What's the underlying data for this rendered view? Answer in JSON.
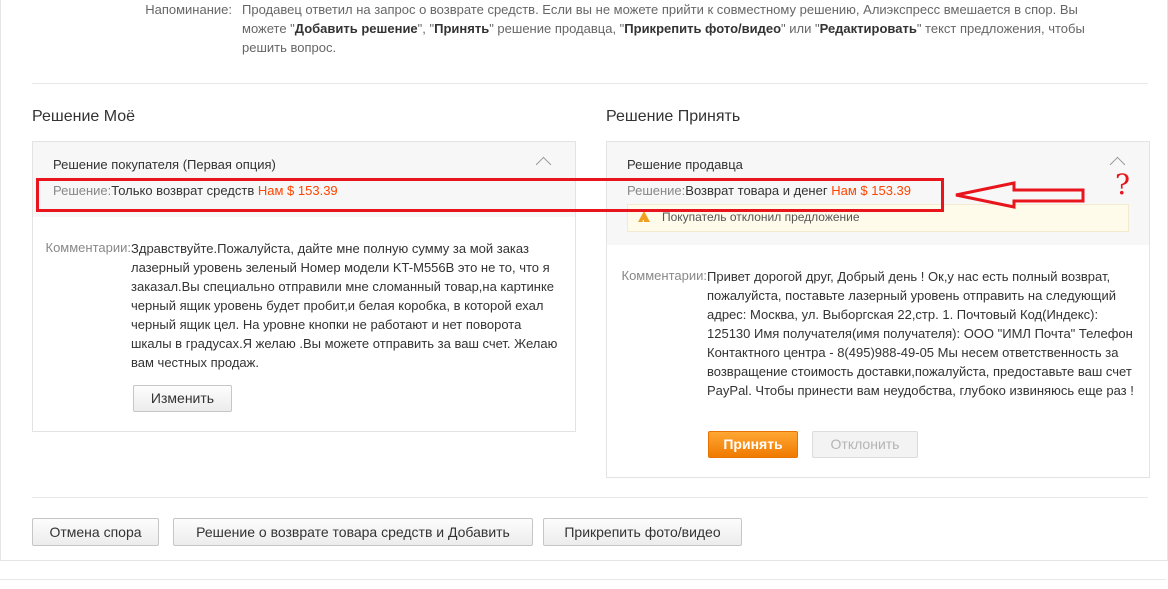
{
  "reminder": {
    "label": "Напоминание:",
    "text_plain1": "Продавец ответил на запрос о возврате средств. Если вы не можете прийти к совместному решению, Алиэкспресс вмешается в спор. Вы можете \"",
    "b1": "Добавить решение",
    "t2": "\", \"",
    "b2": "Принять",
    "t3": "\" решение продавца, \"",
    "b3": "Прикрепить фото/видео",
    "t4": "\" или \"",
    "b4": "Редактировать",
    "t5": "\" текст предложения, чтобы решить вопрос."
  },
  "my_solution": {
    "section_title": "Решение Моё",
    "panel_title": "Решение покупателя (Первая опция)",
    "solution_label": "Решение:",
    "solution_text": "Только возврат средств",
    "amount": "Нам $ 153.39",
    "comment_label": "Комментарии:",
    "comment": "Здравствуйте.Пожалуйста, дайте мне полную сумму за мой заказ лазерный уровень зеленый Номер модели KT-M556B это не то, что я заказал.Вы специально отправили мне сломанный товар,на картинке черный ящик уровень будет пробит,и белая коробка, в которой ехал черный ящик цел. На уровне кнопки не работают и нет поворота шкалы в градусах.Я желаю .Вы можете отправить за ваш счет. Желаю вам честных продаж.",
    "edit_button": "Изменить"
  },
  "seller_solution": {
    "section_title": "Решение Принять",
    "panel_title": "Решение продавца",
    "solution_label": "Решение:",
    "solution_text": "Возврат товара и денег",
    "amount": "Нам $ 153.39",
    "warning": "Покупатель отклонил предложение",
    "comment_label": "Комментарии:",
    "comment": "Привет дорогой друг, Добрый день ! Ок,у нас есть полный возврат, пожалуйста, поставьте лазерный уровень отправить на следующий адрес: Москва, ул. Выборгская 22,стр. 1. Почтовый Код(Индекс): 125130 Имя получателя(имя получателя): ООО \"ИМЛ Почта\" Телефон Контактного центра - 8(495)988-49-05 Мы несем ответственность за возвращение стоимость доставки,пожалуйста, предоставьте ваш счет PayPal. Чтобы принести вам неудобства, глубоко извиняюсь еще раз !",
    "accept_button": "Принять",
    "decline_button": "Отклонить"
  },
  "actions": {
    "cancel_dispute": "Отмена спора",
    "add_solution": "Решение о возврате товара средств и Добавить",
    "attach_media": "Прикрепить фото/видео"
  },
  "annotation": {
    "question_mark": "?",
    "color": "#e8151d"
  }
}
